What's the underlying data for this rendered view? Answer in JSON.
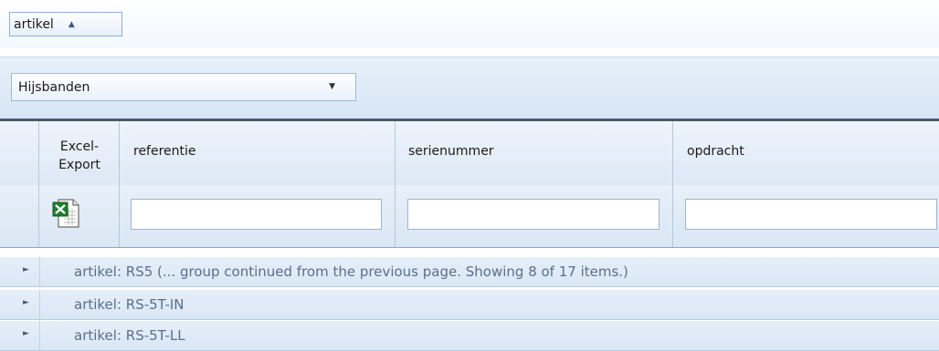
{
  "group_panel": {
    "chip_label": "artikel",
    "chip_arrow": "▲"
  },
  "filter": {
    "selected": "Hijsbanden",
    "arrow": "▼"
  },
  "grid": {
    "columns": [
      {
        "label": "Excel-\nExport"
      },
      {
        "label": "referentie"
      },
      {
        "label": "serienummer"
      },
      {
        "label": "opdracht"
      }
    ],
    "filter_values": {
      "referentie": "",
      "serienummer": "",
      "opdracht": ""
    },
    "groups": [
      {
        "label": "artikel: RS5 (... group continued from the previous page. Showing 8 of 17 items.)"
      },
      {
        "label": "artikel: RS-5T-IN"
      },
      {
        "label": "artikel: RS-5T-LL"
      }
    ],
    "expand_glyph": "►"
  }
}
